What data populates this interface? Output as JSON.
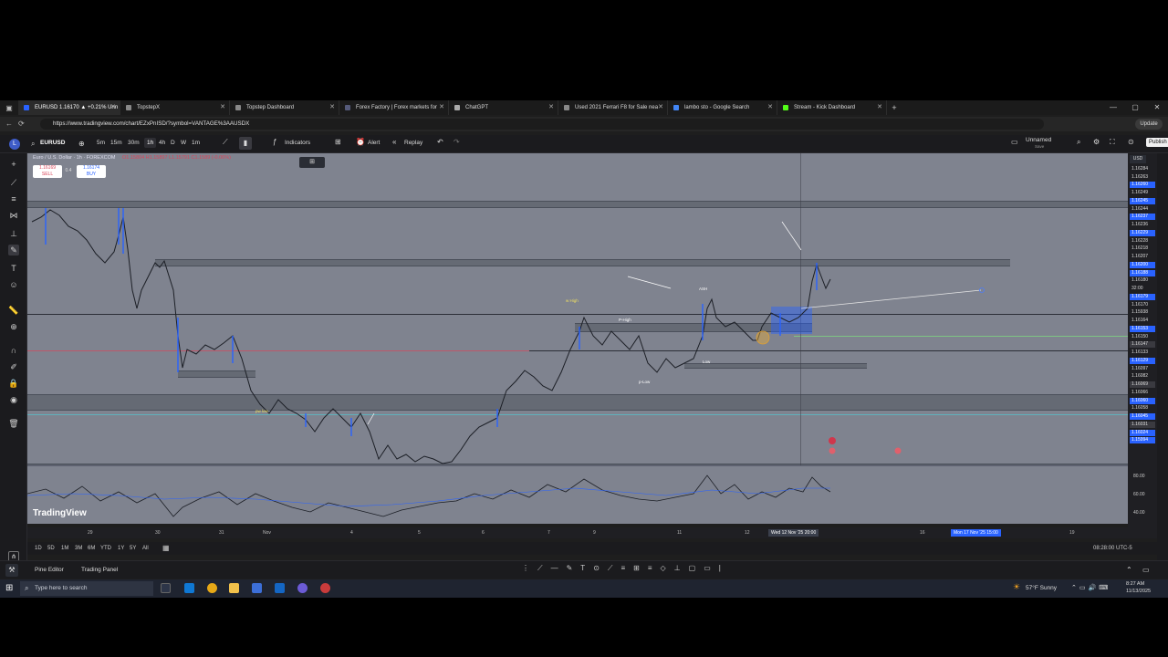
{
  "browser": {
    "tabs": [
      {
        "title": "EURUSD 1.16170 ▲ +0.21% Unn"
      },
      {
        "title": "TopstepX"
      },
      {
        "title": "Topstep Dashboard"
      },
      {
        "title": "Forex Factory | Forex markets for"
      },
      {
        "title": "ChatGPT"
      },
      {
        "title": "Used 2021 Ferrari F8 for Sale nea"
      },
      {
        "title": "lambo sto - Google Search"
      },
      {
        "title": "Stream - Kick Dashboard"
      }
    ],
    "url": "https://www.tradingview.com/chart/EZxPnISD/?symbol=VANTAGE%3AAUSDX",
    "update_label": "Update"
  },
  "toolbar": {
    "symbol": "EURUSD",
    "intervals": [
      "5m",
      "15m",
      "30m",
      "1h",
      "4h",
      "D",
      "W",
      "1m"
    ],
    "indicators_label": "Indicators",
    "alert_label": "Alert",
    "replay_label": "Replay",
    "layout_name": "Unnamed",
    "layout_sub": "Save",
    "publish_label": "Publish"
  },
  "legend": {
    "title": "Euro / U.S. Dollar · 1h · FOREXCOM",
    "ohlc": "O1.15804 H1.15897 L1.15791 C1.1589",
    "change": "(-0.06%)",
    "sell_price": "1.16169",
    "sell_label": "SELL",
    "spread": "0.4",
    "buy_price": "1.16174",
    "buy_label": "BUY"
  },
  "chart_labels": {
    "w_high": "w High",
    "p_high": "P-High",
    "asia_high": "ASH",
    "pw_low": "pw low",
    "p_low": "p-Low",
    "low": "Low",
    "watermark": "TradingView",
    "currency": "USD"
  },
  "price_axis": [
    {
      "v": "1.16284",
      "style": "plain"
    },
    {
      "v": "1.16263",
      "style": "plain"
    },
    {
      "v": "1.16260",
      "style": "blue"
    },
    {
      "v": "1.16249",
      "style": "plain"
    },
    {
      "v": "1.16245",
      "style": "blue"
    },
    {
      "v": "1.16244",
      "style": "plain"
    },
    {
      "v": "1.16237",
      "style": "blue"
    },
    {
      "v": "1.16236",
      "style": "plain"
    },
    {
      "v": "1.16229",
      "style": "blue"
    },
    {
      "v": "1.16228",
      "style": "plain"
    },
    {
      "v": "1.16218",
      "style": "plain"
    },
    {
      "v": "1.16207",
      "style": "plain"
    },
    {
      "v": "1.16200",
      "style": "blue"
    },
    {
      "v": "1.16188",
      "style": "blue"
    },
    {
      "v": "1.16180",
      "style": "plain"
    },
    {
      "v": "32:00",
      "style": "plain"
    },
    {
      "v": "1.16179",
      "style": "blue"
    },
    {
      "v": "1.16170",
      "style": "plain"
    },
    {
      "v": "1.15938",
      "style": "plain"
    },
    {
      "v": "1.16164",
      "style": "plain"
    },
    {
      "v": "1.16153",
      "style": "blue"
    },
    {
      "v": "1.16150",
      "style": "plain"
    },
    {
      "v": "1.16147",
      "style": "dark"
    },
    {
      "v": "1.16133",
      "style": "plain"
    },
    {
      "v": "1.16129",
      "style": "blue"
    },
    {
      "v": "1.16097",
      "style": "plain"
    },
    {
      "v": "1.16082",
      "style": "plain"
    },
    {
      "v": "1.16069",
      "style": "dark"
    },
    {
      "v": "1.16066",
      "style": "plain"
    },
    {
      "v": "1.16060",
      "style": "blue"
    },
    {
      "v": "1.16058",
      "style": "plain"
    },
    {
      "v": "1.16045",
      "style": "blue"
    },
    {
      "v": "1.16031",
      "style": "dark"
    },
    {
      "v": "1.16024",
      "style": "blue"
    },
    {
      "v": "1.15994",
      "style": "blue"
    }
  ],
  "rsi_axis": [
    "80.00",
    "60.00",
    "40.00"
  ],
  "time_axis": [
    "29",
    "30",
    "31",
    "Nov",
    "4",
    "5",
    "6",
    "7",
    "9",
    "11",
    "12",
    "16",
    "19"
  ],
  "time_highlight_left": "Wed 12 Nov '25  20:00",
  "time_highlight_right": "Mon 17 Nov '25  15:00",
  "range_buttons": [
    "1D",
    "5D",
    "1M",
    "3M",
    "6M",
    "YTD",
    "1Y",
    "5Y",
    "All"
  ],
  "clock": "08:28:00 UTC-5",
  "bottom_tabs": [
    "Pine Editor",
    "Trading Panel"
  ],
  "taskbar": {
    "search_placeholder": "Type here to search",
    "weather": "57°F  Sunny",
    "time": "8:27 AM",
    "date": "11/13/2025"
  }
}
